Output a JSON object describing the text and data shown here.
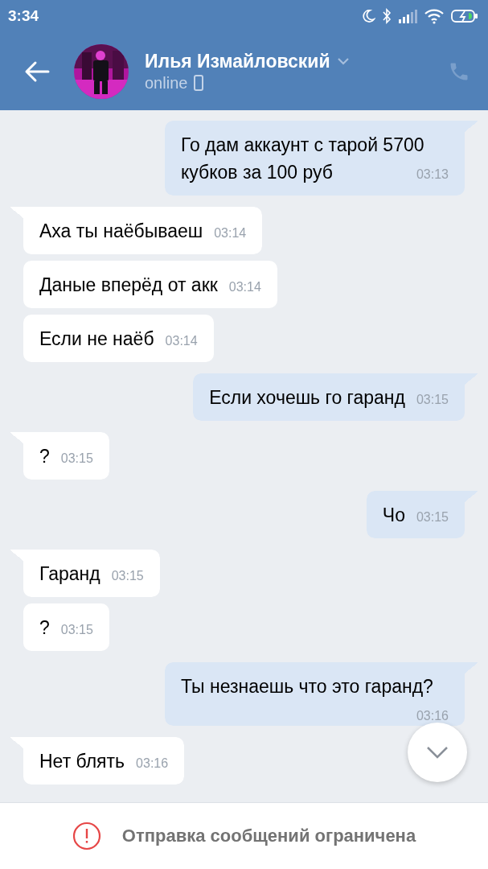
{
  "status_bar": {
    "time": "3:34"
  },
  "header": {
    "name": "Илья Измайловский",
    "status": "online"
  },
  "messages": [
    {
      "kind": "outgoing",
      "first": true,
      "text": "Го дам аккаунт с тарой 5700 кубков за 100 руб",
      "time": "03:13"
    },
    {
      "kind": "incoming",
      "first": true,
      "text": "Аха ты наёбываеш",
      "time": "03:14"
    },
    {
      "kind": "incoming",
      "first": false,
      "text": "Даные вперёд от акк",
      "time": "03:14"
    },
    {
      "kind": "incoming",
      "first": false,
      "text": "Если не наёб",
      "time": "03:14"
    },
    {
      "kind": "outgoing",
      "first": true,
      "text": "Если хочешь го гаранд",
      "time": "03:15"
    },
    {
      "kind": "incoming",
      "first": true,
      "text": "?",
      "time": "03:15"
    },
    {
      "kind": "outgoing",
      "first": true,
      "text": "Чо",
      "time": "03:15"
    },
    {
      "kind": "incoming",
      "first": true,
      "text": "Гаранд",
      "time": "03:15"
    },
    {
      "kind": "incoming",
      "first": false,
      "text": "?",
      "time": "03:15"
    },
    {
      "kind": "outgoing",
      "first": true,
      "text": "Ты незнаешь что это гаранд?",
      "time": "03:16"
    },
    {
      "kind": "incoming",
      "first": true,
      "text": "Нет блять",
      "time": "03:16"
    }
  ],
  "footer": {
    "notice": "Отправка сообщений ограничена"
  }
}
